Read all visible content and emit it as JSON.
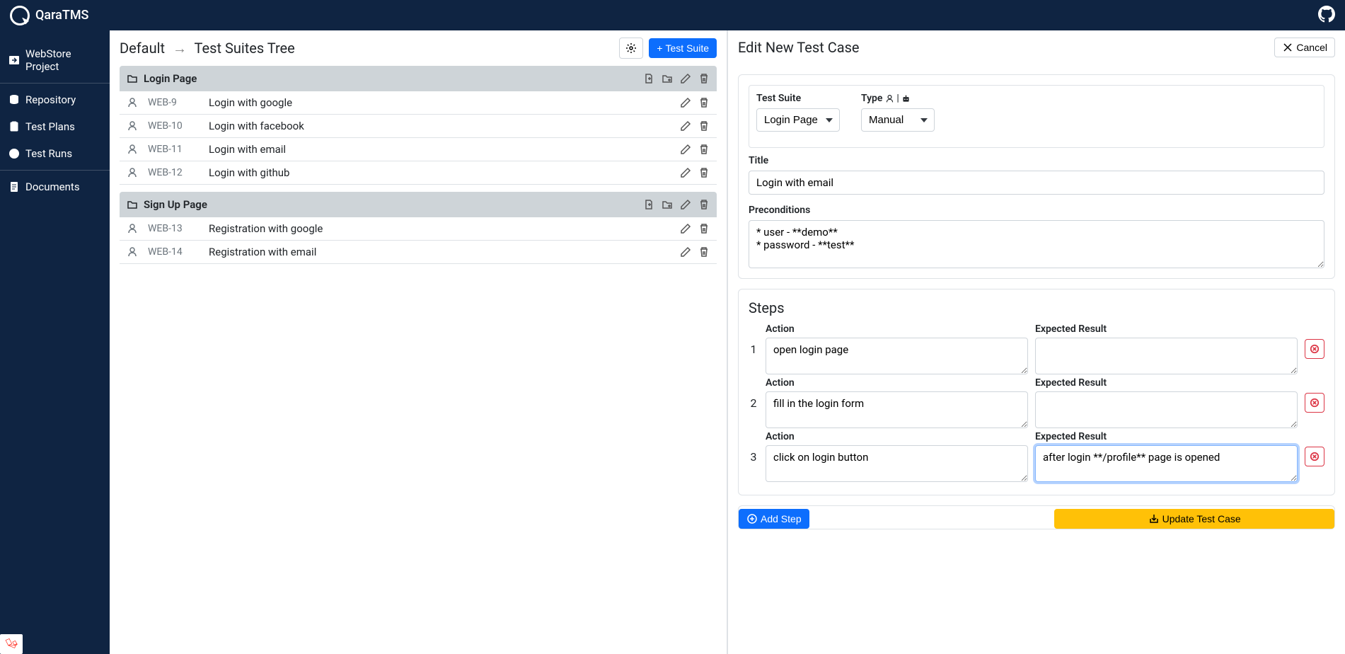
{
  "app": {
    "name": "QaraTMS"
  },
  "sidebar": {
    "project": {
      "label": "WebStore Project"
    },
    "repository": {
      "label": "Repository"
    },
    "testPlans": {
      "label": "Test Plans"
    },
    "testRuns": {
      "label": "Test Runs"
    },
    "documents": {
      "label": "Documents"
    }
  },
  "breadcrumb": {
    "root": "Default",
    "child": "Test Suites Tree"
  },
  "buttons": {
    "testSuite": "Test Suite",
    "cancel": "Cancel",
    "addStep": "Add Step",
    "updateTestCase": "Update Test Case"
  },
  "suites": [
    {
      "name": "Login Page",
      "cases": [
        {
          "id": "WEB-9",
          "name": "Login with google"
        },
        {
          "id": "WEB-10",
          "name": "Login with facebook"
        },
        {
          "id": "WEB-11",
          "name": "Login with email"
        },
        {
          "id": "WEB-12",
          "name": "Login with github"
        }
      ]
    },
    {
      "name": "Sign Up Page",
      "cases": [
        {
          "id": "WEB-13",
          "name": "Registration with google"
        },
        {
          "id": "WEB-14",
          "name": "Registration with email"
        }
      ]
    }
  ],
  "editor": {
    "title": "Edit New Test Case",
    "labels": {
      "testSuite": "Test Suite",
      "type": "Type",
      "title": "Title",
      "preconditions": "Preconditions",
      "steps": "Steps",
      "action": "Action",
      "expected": "Expected Result"
    },
    "values": {
      "testSuite": "Login Page",
      "type": "Manual",
      "title": "Login with email",
      "preconditions": "* user - **demo**\n* password - **test**"
    },
    "steps": [
      {
        "num": "1",
        "action": "open login page",
        "expected": ""
      },
      {
        "num": "2",
        "action": "fill in the login form",
        "expected": ""
      },
      {
        "num": "3",
        "action": "click on login button",
        "expected": "after login **/profile** page is opened"
      }
    ]
  }
}
